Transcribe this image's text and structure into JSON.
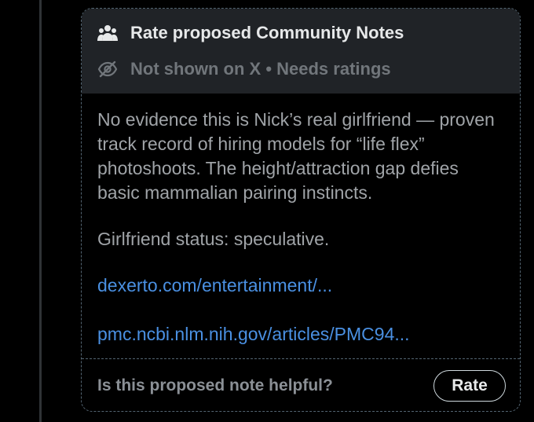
{
  "header": {
    "title": "Rate proposed Community Notes",
    "title_icon": "people-icon",
    "status": "Not shown on X • Needs ratings",
    "status_icon": "eye-slash-icon"
  },
  "note": {
    "paragraph1": "No evidence this is Nick’s real girlfriend — proven track record of hiring models for “life flex” photoshoots. The height/attraction gap defies basic mammalian pairing instincts.",
    "paragraph2": "Girlfriend status: speculative.",
    "links": [
      "dexerto.com/entertainment/...",
      "pmc.ncbi.nlm.nih.gov/articles/PMC94..."
    ]
  },
  "footer": {
    "question": "Is this proposed note helpful?",
    "rate_label": "Rate"
  },
  "colors": {
    "background": "#000000",
    "header_bg": "#202327",
    "link": "#4a90e2",
    "text_primary": "#e7e9ea",
    "text_muted": "#71767b"
  }
}
